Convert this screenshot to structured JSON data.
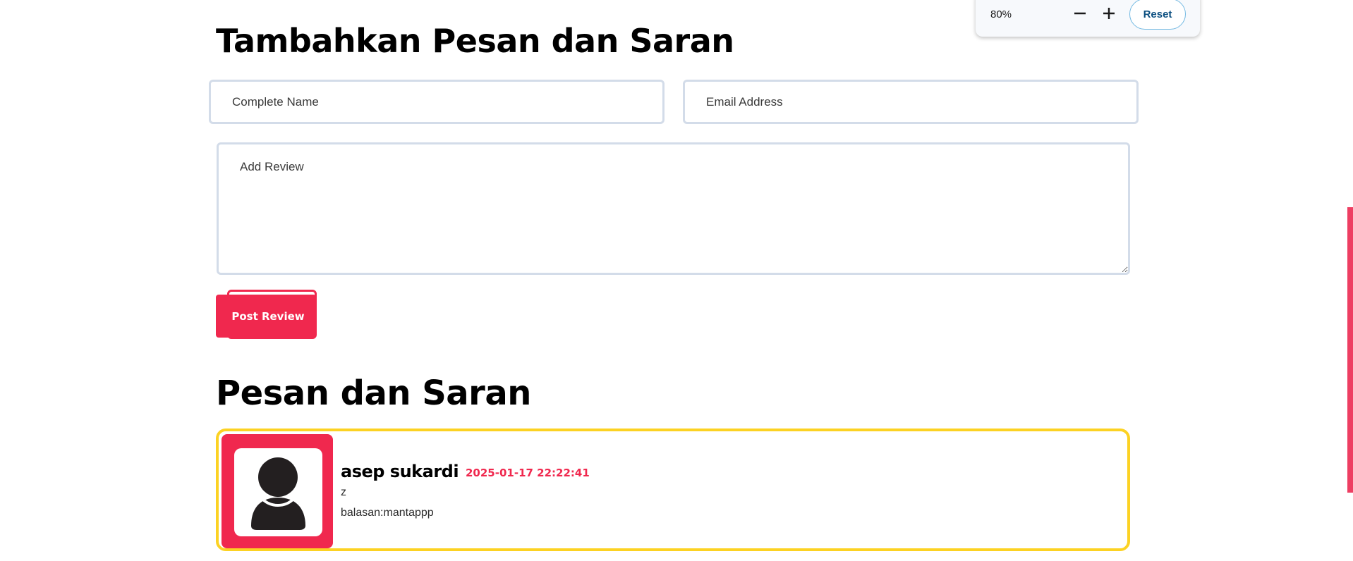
{
  "form": {
    "title": "Tambahkan Pesan dan Saran",
    "name_placeholder": "Complete Name",
    "email_placeholder": "Email Address",
    "review_placeholder": "Add Review",
    "submit_label": "Post Review"
  },
  "reviews_section": {
    "title": "Pesan dan Saran",
    "items": [
      {
        "name": "asep sukardi",
        "date": "2025-01-17 22:22:41",
        "text": "z",
        "reply": "balasan:mantappp"
      }
    ]
  },
  "zoom": {
    "level": "80%",
    "reset_label": "Reset",
    "zoom_out_icon": "minus-icon",
    "zoom_in_icon": "plus-icon"
  },
  "colors": {
    "accent": "#f0284e",
    "card_border": "#fcd223",
    "input_border": "#d3dce9",
    "reset_text": "#0c4f80"
  }
}
